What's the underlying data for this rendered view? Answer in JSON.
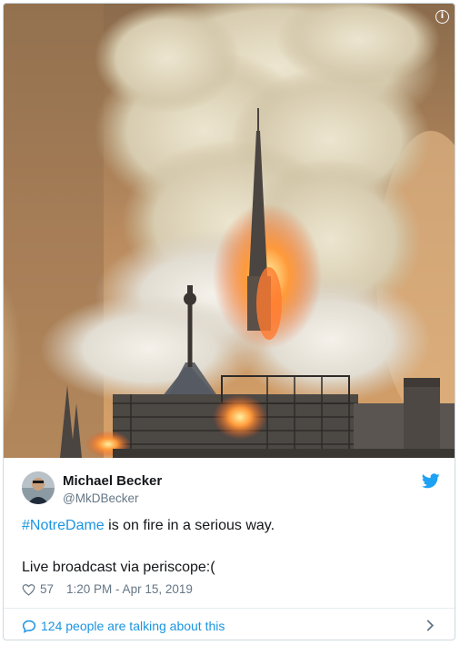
{
  "tweet": {
    "author_name": "Michael Becker",
    "author_handle": "@MkDBecker",
    "hashtag": "#NotreDame",
    "text_rest": " is on fire in a serious way.",
    "line2": "Live broadcast via periscope:(",
    "like_count": "57",
    "timestamp": "1:20 PM - Apr 15, 2019",
    "talking": "124 people are talking about this",
    "info_label": "i"
  },
  "icons": {
    "info": "info-icon",
    "bird": "twitter-bird-icon",
    "heart": "heart-icon",
    "reply": "speech-bubble-icon",
    "chevron": "chevron-right-icon"
  },
  "colors": {
    "link": "#1b95e0",
    "secondary": "#657786",
    "text": "#14171a",
    "border": "#cfd9de"
  }
}
